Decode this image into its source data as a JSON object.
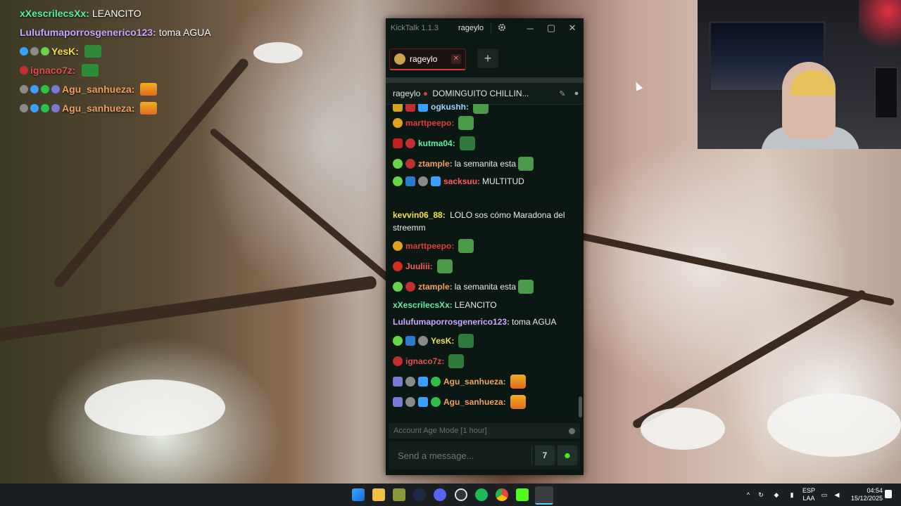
{
  "overlay": {
    "messages": [
      {
        "user": "xXescrilecsXx:",
        "text": "LEANCITO",
        "color": "#5ef0a0"
      },
      {
        "user": "Lulufumaporrosgenerico123:",
        "text": "toma AGUA",
        "color": "#c8a8ff"
      },
      {
        "user": "YesK:",
        "text": "",
        "color": "#f2e04a"
      },
      {
        "user": "ignaco7z:",
        "text": "",
        "color": "#e05050"
      },
      {
        "user": "Agu_sanhueza:",
        "text": "",
        "color": "#f0a060"
      },
      {
        "user": "Agu_sanhueza:",
        "text": "",
        "color": "#f0a060"
      }
    ]
  },
  "app": {
    "title": "KickTalk 1.1.3",
    "titlebar_user": "rageylo",
    "settings_icon": "gear-icon",
    "tab_label": "rageylo",
    "tab_close": "✕",
    "add_tab": "+",
    "channel_name": "rageylo",
    "stream_title": "DOMINGUITO CHILLIN...",
    "account_age": "Account Age Mode [1 hour]",
    "input_placeholder": "Send a message...",
    "accent": "#53fc18",
    "live_color": "#e04040"
  },
  "chat": [
    {
      "user": "ogkushh:",
      "text": "",
      "color": "#9fd4ff"
    },
    {
      "user": "marttpeepo:",
      "text": "",
      "color": "#e03a3a"
    },
    {
      "user": "kutma04:",
      "text": "",
      "color": "#5ef0a0"
    },
    {
      "user": "ztample:",
      "text": "la semanita esta",
      "color": "#f0a060"
    },
    {
      "user": "sacksuu:",
      "text": "MULTITUD",
      "color": "#ff5a5a"
    },
    {
      "user": "kevvin06_88:",
      "text": "LOLO sos cómo Maradona del streemm",
      "color": "#f2e04a"
    },
    {
      "user": "marttpeepo:",
      "text": "",
      "color": "#e03a3a"
    },
    {
      "user": "Juuliii:",
      "text": "",
      "color": "#ff5a5a"
    },
    {
      "user": "ztample:",
      "text": "la semanita esta",
      "color": "#f0a060"
    },
    {
      "user": "xXescrilecsXx:",
      "text": "LEANCITO",
      "color": "#5ef0a0"
    },
    {
      "user": "Lulufumaporrosgenerico123:",
      "text": "toma AGUA",
      "color": "#c8a8ff"
    },
    {
      "user": "YesK:",
      "text": "",
      "color": "#f2e04a"
    },
    {
      "user": "ignaco7z:",
      "text": "",
      "color": "#e05050"
    },
    {
      "user": "Agu_sanhueza:",
      "text": "",
      "color": "#f0a060"
    },
    {
      "user": "Agu_sanhueza:",
      "text": "",
      "color": "#f0a060"
    }
  ],
  "taskbar": {
    "lang_top": "ESP",
    "lang_bottom": "LAA",
    "time": "04:54",
    "date": "15/12/2025"
  }
}
